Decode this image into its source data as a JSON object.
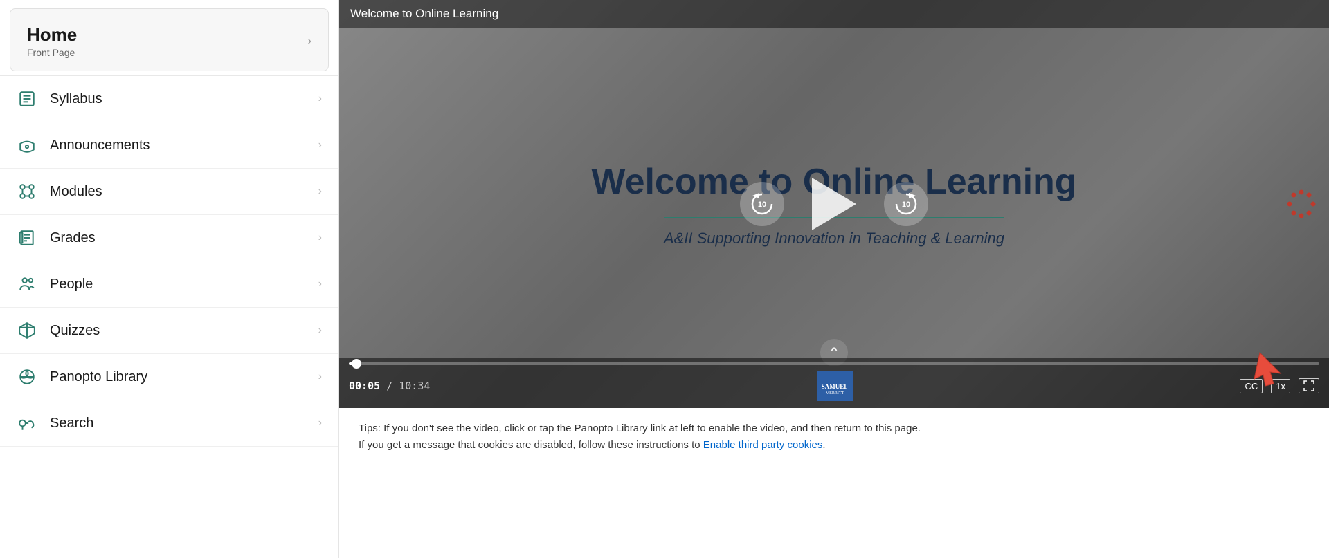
{
  "sidebar": {
    "home": {
      "title": "Home",
      "subtitle": "Front Page"
    },
    "items": [
      {
        "id": "syllabus",
        "label": "Syllabus",
        "icon": "syllabus"
      },
      {
        "id": "announcements",
        "label": "Announcements",
        "icon": "announcements"
      },
      {
        "id": "modules",
        "label": "Modules",
        "icon": "modules"
      },
      {
        "id": "grades",
        "label": "Grades",
        "icon": "grades"
      },
      {
        "id": "people",
        "label": "People",
        "icon": "people"
      },
      {
        "id": "quizzes",
        "label": "Quizzes",
        "icon": "quizzes"
      },
      {
        "id": "panopto",
        "label": "Panopto Library",
        "icon": "panopto"
      },
      {
        "id": "search",
        "label": "Search",
        "icon": "search"
      }
    ]
  },
  "video": {
    "title": "Welcome to Online Learning",
    "slide_title": "Welcome to Online Learning",
    "slide_subtitle": "A&II Supporting Innovation in Teaching & Learning",
    "time_current": "00:05",
    "time_total": "10:34",
    "speed": "1x",
    "cc_label": "CC",
    "fullscreen_label": "⛶",
    "rewind_seconds": "10",
    "forward_seconds": "10"
  },
  "tips": {
    "text1": "Tips: If you don't see the video, click or tap the Panopto Library link at left to enable the video, and then return to this page.",
    "text2": "If you get a message that cookies are disabled, follow these instructions to ",
    "link_text": "Enable third party cookies",
    "text3": "."
  }
}
